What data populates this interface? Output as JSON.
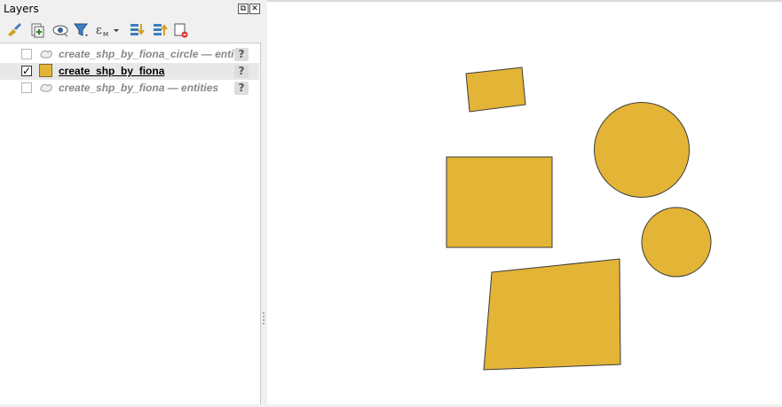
{
  "panel": {
    "title": "Layers",
    "float_label": "⧉",
    "close_label": "✕"
  },
  "toolbar": {
    "icons": [
      "style-brush-icon",
      "add-group-icon",
      "visibility-eye-icon",
      "filter-icon",
      "expression-filter-icon",
      "expand-all-icon",
      "collapse-all-icon",
      "remove-layer-icon"
    ]
  },
  "layers": [
    {
      "name": "create_shp_by_fiona_circle — entities",
      "checked": false,
      "active": false,
      "qmark": "?"
    },
    {
      "name": "create_shp_by_fiona",
      "checked": true,
      "active": true,
      "qmark": "?"
    },
    {
      "name": "create_shp_by_fiona — entities",
      "checked": false,
      "active": false,
      "qmark": "?"
    }
  ],
  "colors": {
    "feature_fill": "#e3b436",
    "feature_stroke": "#3a3a3a"
  }
}
